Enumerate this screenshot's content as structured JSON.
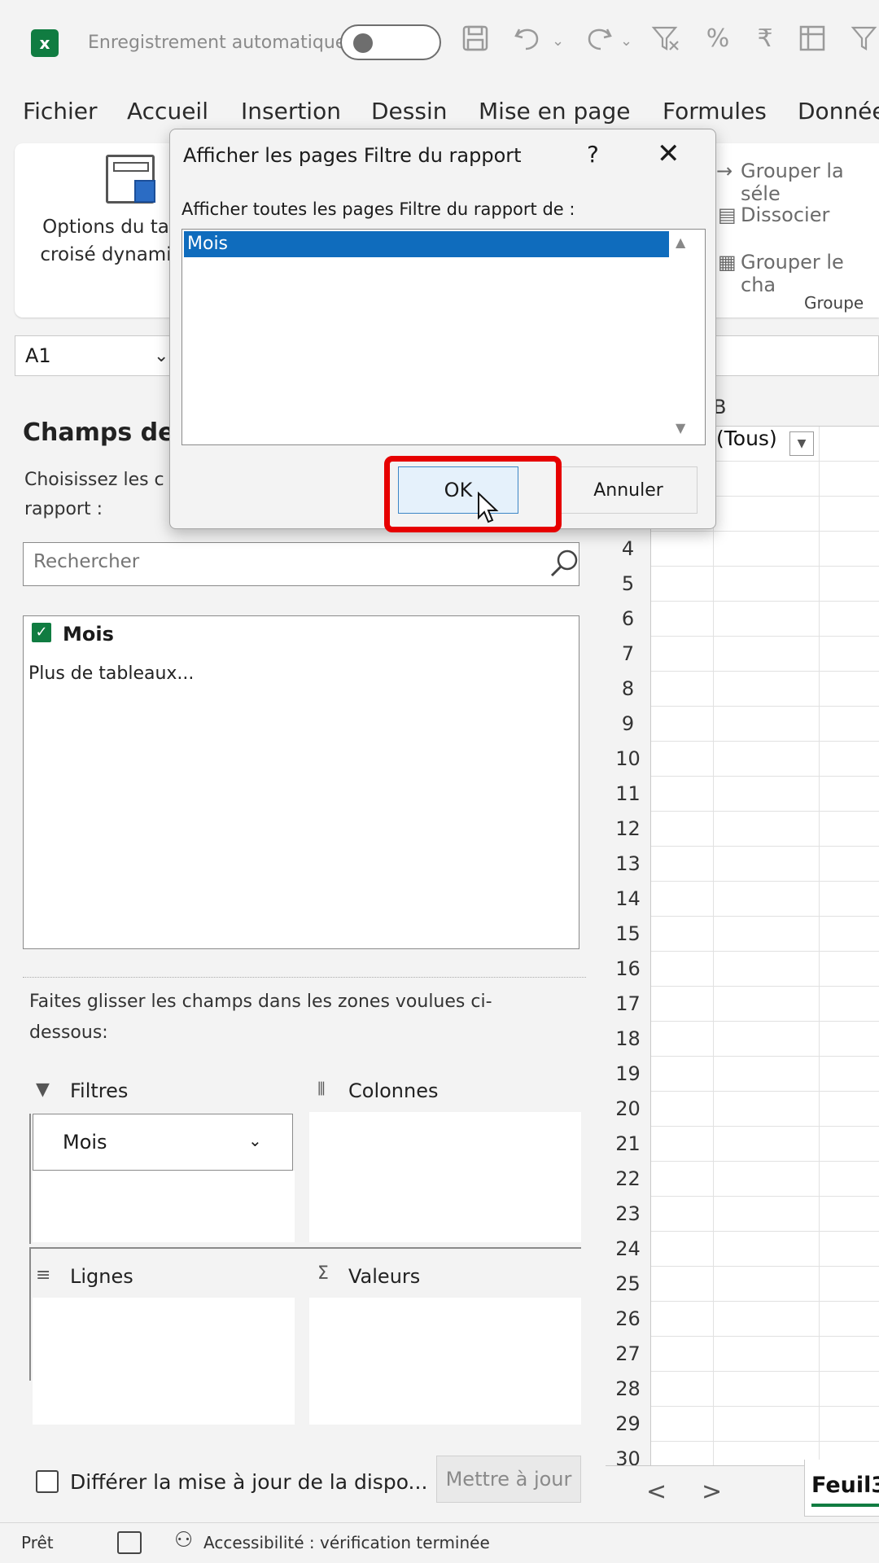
{
  "titlebar": {
    "app_icon": "excel-icon",
    "app_letter": "x",
    "autosave_label": "Enregistrement automatique",
    "qat_icons": [
      "save-icon",
      "undo-icon",
      "redo-icon",
      "clear-filter-icon",
      "percent-icon",
      "sort-icon",
      "freeze-icon",
      "filter-icon"
    ]
  },
  "menu": {
    "items": [
      "Fichier",
      "Accueil",
      "Insertion",
      "Dessin",
      "Mise en page",
      "Formules",
      "Donnée"
    ]
  },
  "ribbon": {
    "pivot_options_label": "Options du ta croisé dynami",
    "group_selection": "Grouper la séle",
    "ungroup": "Dissocier",
    "group_field": "Grouper le cha",
    "group_caption": "Groupe"
  },
  "namebox": {
    "value": "A1"
  },
  "pane": {
    "title": "Champs de t",
    "subtitle": "Choisissez les c rapport :",
    "search_placeholder": "Rechercher",
    "fields": [
      {
        "label": "Mois",
        "checked": true
      }
    ],
    "more_tables": "Plus de tableaux...",
    "drag_hint": "Faites glisser les champs dans les zones voulues ci-dessous:",
    "areas": {
      "filters_label": "Filtres",
      "columns_label": "Colonnes",
      "rows_label": "Lignes",
      "values_label": "Valeurs",
      "filter_item": "Mois"
    },
    "defer_label": "Différer la mise à jour de la dispo...",
    "update_button": "Mettre à jour"
  },
  "grid": {
    "col_header": "B",
    "filter_cell_value": "(Tous)",
    "row_numbers": [
      "4",
      "5",
      "6",
      "7",
      "8",
      "9",
      "10",
      "11",
      "12",
      "13",
      "14",
      "15",
      "16",
      "17",
      "18",
      "19",
      "20",
      "21",
      "22",
      "23",
      "24",
      "25",
      "26",
      "27",
      "28",
      "29",
      "30"
    ]
  },
  "sheet_tabs": {
    "prev": "<",
    "next": ">",
    "active_tab": "Feuil3"
  },
  "statusbar": {
    "ready": "Prêt",
    "accessibility": "Accessibilité : vérification terminée"
  },
  "dialog": {
    "title": "Afficher les pages Filtre du rapport",
    "help": "?",
    "close": "✕",
    "prompt": "Afficher toutes les pages Filtre du rapport de :",
    "list_items": [
      "Mois"
    ],
    "ok_label": "OK",
    "cancel_label": "Annuler"
  },
  "colors": {
    "excel_green": "#107c41",
    "selection_blue": "#0f6cbd",
    "highlight_red": "#e60000"
  }
}
